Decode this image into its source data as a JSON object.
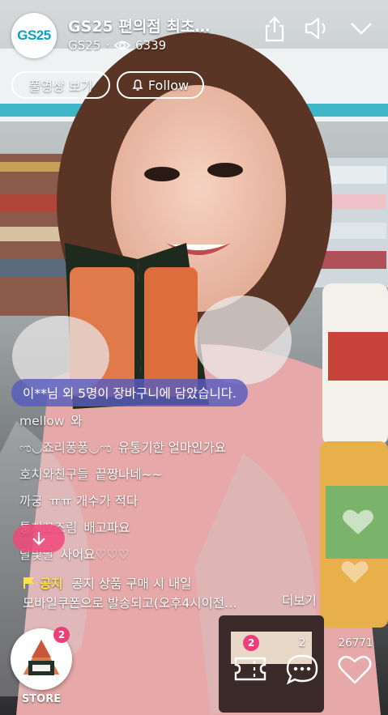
{
  "header": {
    "logo_text": "GS25",
    "title": "GS25 편의점 최초…",
    "channel": "GS25",
    "separator": "·",
    "view_count": "6339",
    "icons": [
      "share-icon",
      "volume-icon",
      "chevron-down-icon"
    ]
  },
  "actions": {
    "full_video_label": "풀영상 보기",
    "follow_label": "Follow"
  },
  "cart_banner": "이**님 외 5명이 장바구니에 담았습니다.",
  "chat": [
    {
      "name": "mellow",
      "text": "와"
    },
    {
      "name": "ಌ◡죠리퐁퐁◡ಌ",
      "text": "유통기한 얼마인가요"
    },
    {
      "name": "호치와친구들",
      "text": "끝짱나네~~"
    },
    {
      "name": "까궁",
      "text": "ㅠㅠ 개수가 적다"
    },
    {
      "name": "퉁치꼬조림",
      "text": "배고파요"
    },
    {
      "name": "달빛달",
      "text": "사어요♡♡♡"
    }
  ],
  "notice": {
    "label": "공지",
    "line1": "공지 상품 구매 시 내일",
    "line2": "모바일쿠폰으로 발송되고(오후4시이전…",
    "more": "더보기"
  },
  "bottom": {
    "store_label": "STORE",
    "store_badge": "2",
    "coupon_badge": "2",
    "comment_count": "2",
    "like_count": "26771"
  },
  "colors": {
    "accent_pink": "#ee3e7a",
    "banner_purple": "#5a5cbe",
    "notice_yellow": "#ffe14d",
    "gs25_blue": "#0aa0c8"
  }
}
